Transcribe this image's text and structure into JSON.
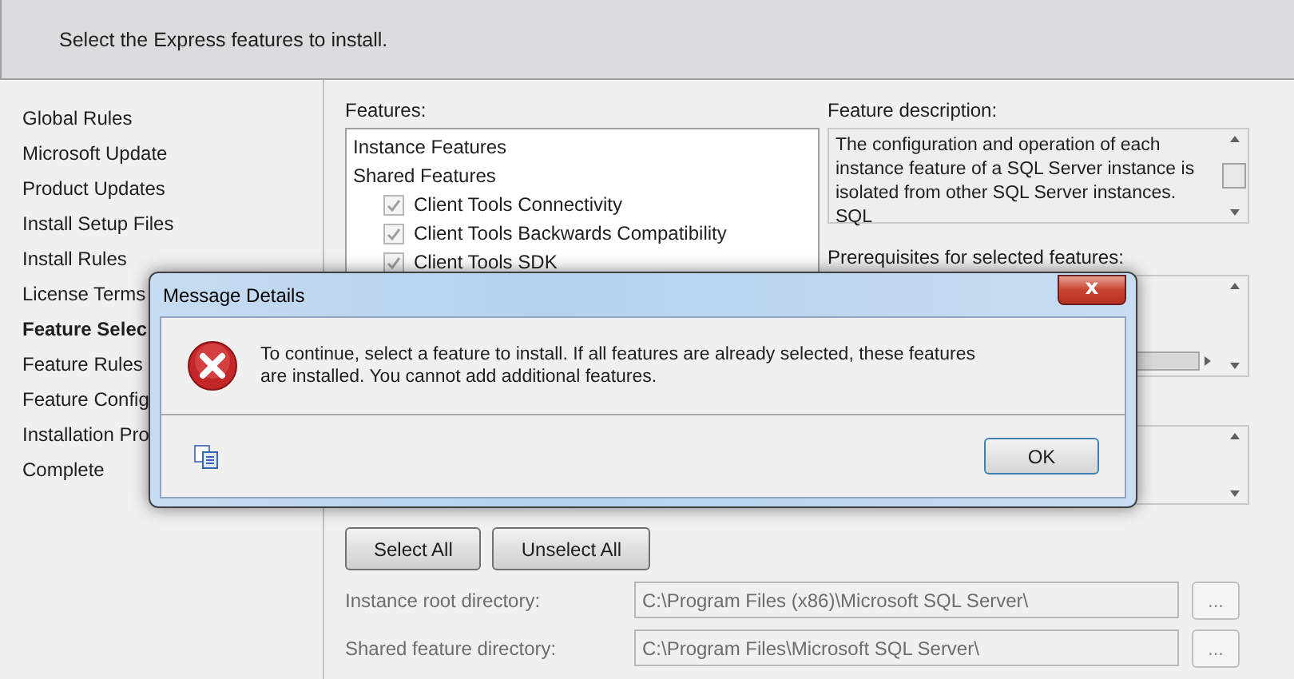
{
  "header": {
    "subtitle": "Select the Express features to install."
  },
  "sidebar": {
    "items": [
      {
        "label": "Global Rules",
        "selected": false
      },
      {
        "label": "Microsoft Update",
        "selected": false
      },
      {
        "label": "Product Updates",
        "selected": false
      },
      {
        "label": "Install Setup Files",
        "selected": false
      },
      {
        "label": "Install Rules",
        "selected": false
      },
      {
        "label": "License Terms",
        "selected": false
      },
      {
        "label": "Feature Selec",
        "selected": true
      },
      {
        "label": "Feature Rules",
        "selected": false
      },
      {
        "label": "Feature Config",
        "selected": false
      },
      {
        "label": "Installation Pro",
        "selected": false
      },
      {
        "label": "Complete",
        "selected": false
      }
    ]
  },
  "features": {
    "label": "Features:",
    "items": [
      {
        "text": "Instance Features"
      },
      {
        "text": "Shared Features",
        "children": [
          {
            "text": "Client Tools Connectivity",
            "checked": true,
            "disabled": true
          },
          {
            "text": "Client Tools Backwards Compatibility",
            "checked": true,
            "disabled": true
          },
          {
            "text": "Client Tools SDK",
            "checked": true,
            "disabled": true
          }
        ]
      }
    ]
  },
  "description": {
    "label": "Feature description:",
    "text": "The configuration and operation of each instance feature of a SQL Server instance is isolated from other SQL Server instances. SQL"
  },
  "prerequisites": {
    "label": "Prerequisites for selected features:"
  },
  "buttons": [
    "Select All",
    "Unselect All"
  ],
  "directories": [
    {
      "label": "Instance root directory:",
      "value": "C:\\Program Files (x86)\\Microsoft SQL Server\\",
      "browse": "..."
    },
    {
      "label": "Shared feature directory:",
      "value": "C:\\Program Files\\Microsoft SQL Server\\",
      "browse": "..."
    }
  ],
  "dialog": {
    "title": "Message Details",
    "close": "x",
    "message": "To continue, select a feature to install. If all features are already selected, these features are installed. You cannot add additional features.",
    "button": "OK"
  }
}
